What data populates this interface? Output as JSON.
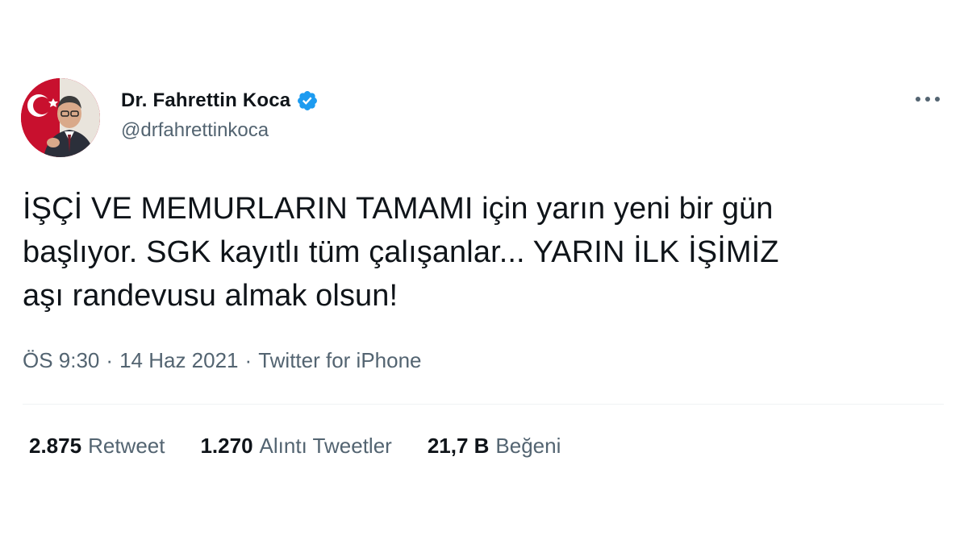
{
  "author": {
    "display_name": "Dr. Fahrettin Koca",
    "handle": "@drfahrettinkoca",
    "verified_icon": "verified-badge-icon",
    "avatar": "profile-photo"
  },
  "menu": {
    "more_icon": "more-horizontal-icon"
  },
  "tweet": {
    "text": "İŞÇİ VE MEMURLARIN TAMAMI için yarın yeni bir gün\nbaşlıyor. SGK kayıtlı tüm çalışanlar... YARIN İLK İŞİMİZ\naşı randevusu almak olsun!",
    "time": "ÖS 9:30",
    "date": "14 Haz 2021",
    "source": "Twitter for iPhone",
    "separator": "·"
  },
  "stats": [
    {
      "count": "2.875",
      "label": "Retweet"
    },
    {
      "count": "1.270",
      "label": "Alıntı Tweetler"
    },
    {
      "count": "21,7 B",
      "label": "Beğeni"
    }
  ],
  "colors": {
    "text_primary": "#0f1419",
    "text_secondary": "#536471",
    "verified_blue": "#1d9bf0",
    "divider": "#eff3f4"
  }
}
